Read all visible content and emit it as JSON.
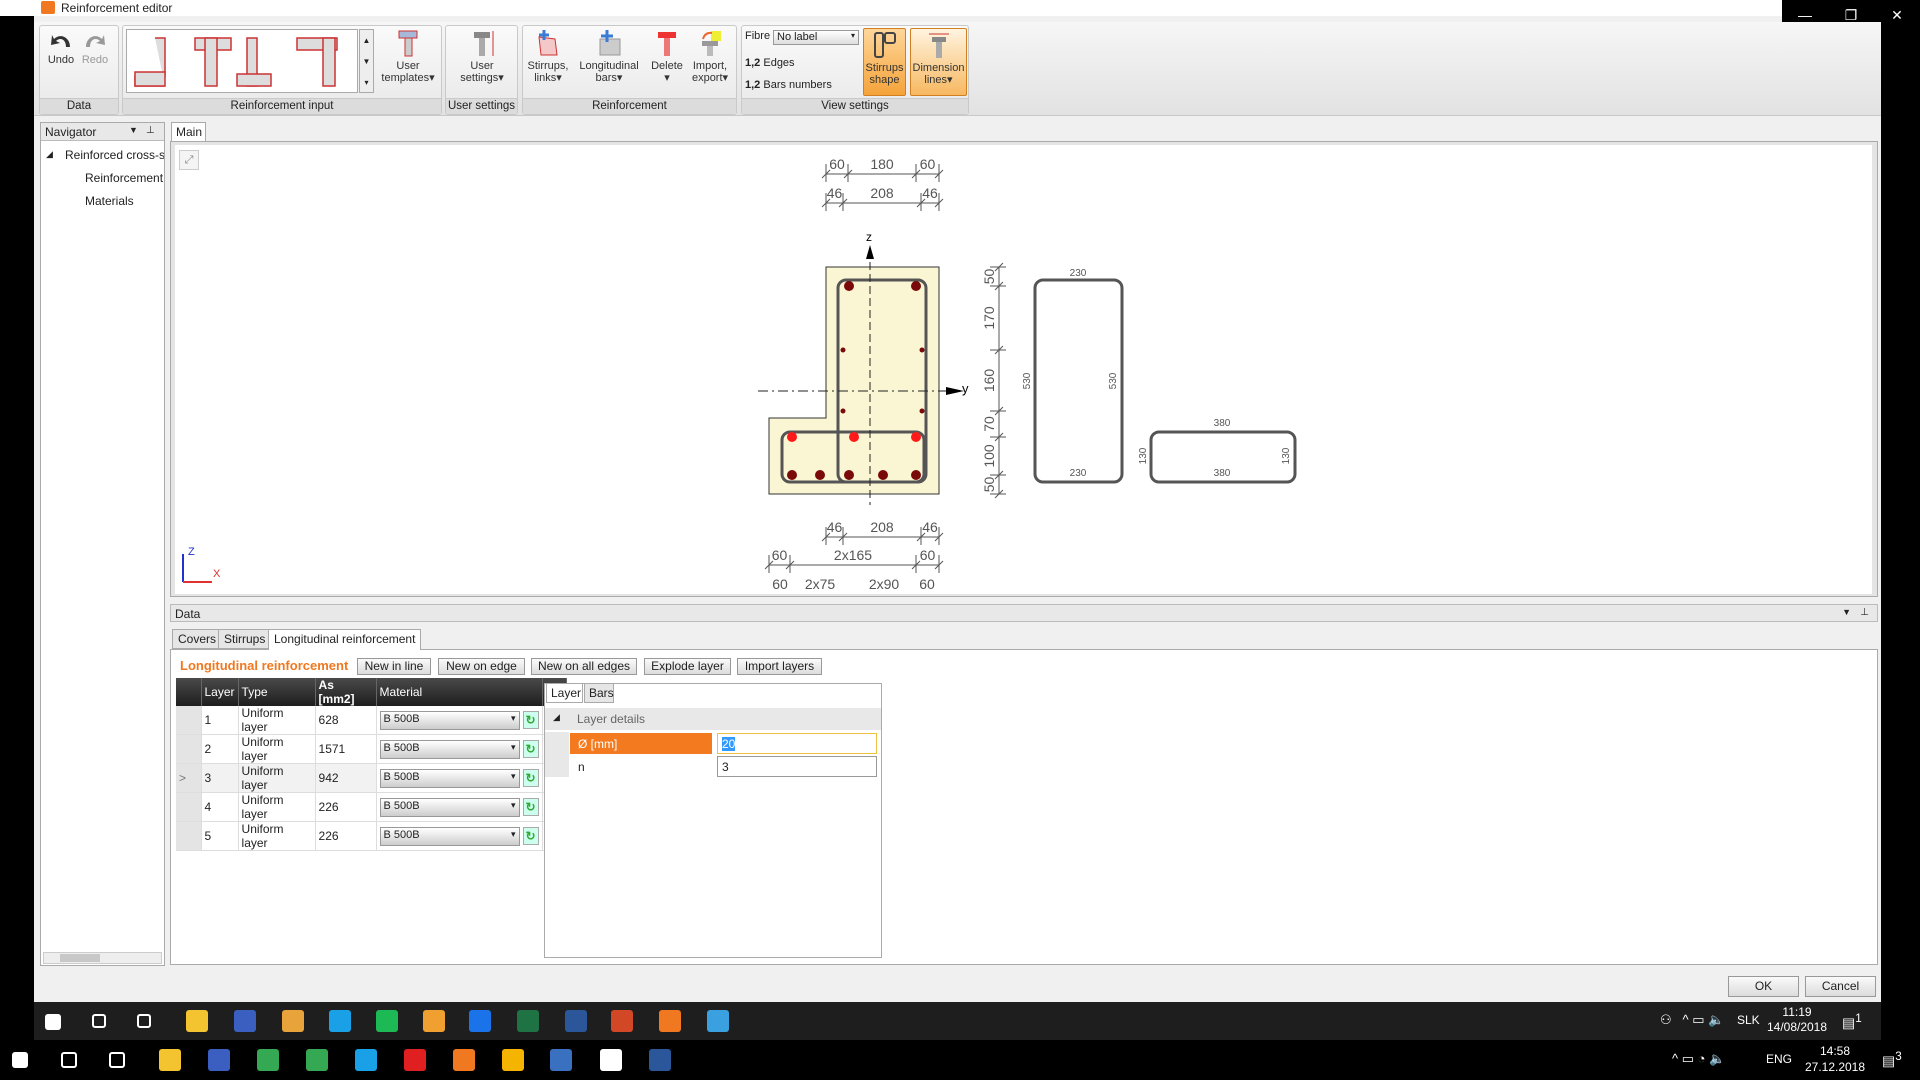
{
  "window": {
    "title": "Reinforcement editor",
    "controls": [
      "—",
      "❐",
      "✕"
    ]
  },
  "ribbon": {
    "groups": [
      "Data",
      "Reinforcement input",
      "User settings",
      "Reinforcement",
      "View settings"
    ],
    "undo": "Undo",
    "redo": "Redo",
    "user_templates": [
      "User",
      "templates▾"
    ],
    "user_settings": [
      "User",
      "settings▾"
    ],
    "stirrups_links": [
      "Stirrups,",
      "links▾"
    ],
    "longitudinal_bars": [
      "Longitudinal",
      "bars▾"
    ],
    "delete": [
      "Delete",
      "▾"
    ],
    "import_export": [
      "Import,",
      "export▾"
    ],
    "fibre_label": "Fibre",
    "fibre_value": "No label",
    "edges": "Edges",
    "bars_numbers": "Bars numbers",
    "num_prefix": "1,2",
    "stirrups_shape": [
      "Stirrups",
      "shape"
    ],
    "dimension_lines": [
      "Dimension",
      "lines▾"
    ],
    "accent": "#f5a33a"
  },
  "navigator": {
    "title": "Navigator",
    "items": [
      "Reinforced cross-se",
      "Reinforcement",
      "Materials"
    ]
  },
  "main": {
    "tab": "Main"
  },
  "drawing": {
    "axes": {
      "z": "z",
      "y": "y",
      "cs_z": "Z",
      "cs_x": "X"
    },
    "dims_top1": [
      "60",
      "180",
      "60"
    ],
    "dims_top2": [
      "46",
      "208",
      "46"
    ],
    "dims_bot1": [
      "46",
      "208",
      "46"
    ],
    "dims_bot2": [
      "60",
      "2x165",
      "60"
    ],
    "dims_bot3": [
      "60",
      "2x75",
      "2x90",
      "60"
    ],
    "dims_vert": [
      "50",
      "170",
      "160",
      "70",
      "100",
      "50"
    ],
    "stirrup1": {
      "top": "230",
      "bottom": "230",
      "left": "530",
      "right": "530"
    },
    "stirrup2": {
      "top": "380",
      "bottom": "380",
      "left": "130",
      "right": "130"
    },
    "concrete_color": "#faf5d2",
    "bar_color": "#7a0a0a",
    "selected_bar_color": "#ff1a1a"
  },
  "data_panel": {
    "title": "Data",
    "tabs": [
      "Covers",
      "Stirrups",
      "Longitudinal reinforcement"
    ],
    "section_title": "Longitudinal reinforcement",
    "buttons": [
      "New in line",
      "New on edge",
      "New on all edges",
      "Explode layer",
      "Import layers"
    ],
    "columns": [
      "Layer",
      "Type",
      "As [mm2]",
      "Material"
    ],
    "rows": [
      {
        "layer": "1",
        "type": "Uniform layer",
        "as": "628",
        "material": "B 500B"
      },
      {
        "layer": "2",
        "type": "Uniform layer",
        "as": "1571",
        "material": "B 500B"
      },
      {
        "layer": "3",
        "type": "Uniform layer",
        "as": "942",
        "material": "B 500B",
        "marker": ">"
      },
      {
        "layer": "4",
        "type": "Uniform layer",
        "as": "226",
        "material": "B 500B"
      },
      {
        "layer": "5",
        "type": "Uniform layer",
        "as": "226",
        "material": "B 500B"
      }
    ],
    "detail_tabs": [
      "Layer",
      "Bars"
    ],
    "details_header": "Layer details",
    "props": [
      {
        "name": "Ø [mm]",
        "value": "20"
      },
      {
        "name": "n",
        "value": "3"
      }
    ]
  },
  "dialog": {
    "ok": "OK",
    "cancel": "Cancel"
  },
  "taskbar_inner": {
    "lang": "SLK",
    "time": "11:19",
    "date": "14/08/2018",
    "notif": "1"
  },
  "taskbar_outer": {
    "lang": "ENG",
    "time": "14:58",
    "date": "27.12.2018",
    "notif": "3"
  }
}
